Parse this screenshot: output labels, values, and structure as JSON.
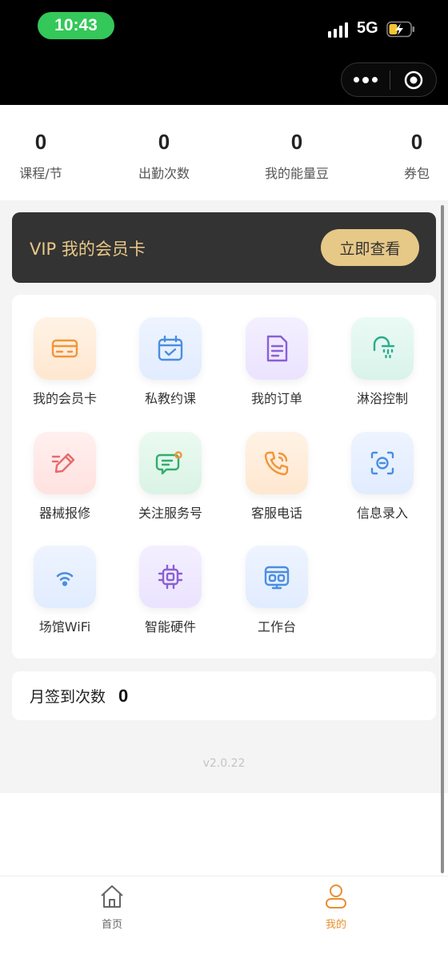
{
  "status_bar": {
    "time": "10:43",
    "network": "5G",
    "battery_color": "#f6c531"
  },
  "capsule": {
    "more_icon": "more-dots-icon",
    "close_icon": "target-circle-icon"
  },
  "stats": [
    {
      "value": "0",
      "label": "课程/节"
    },
    {
      "value": "0",
      "label": "出勤次数"
    },
    {
      "value": "0",
      "label": "我的能量豆"
    },
    {
      "value": "0",
      "label": "券包"
    }
  ],
  "vip": {
    "title": "VIP 我的会员卡",
    "button": "立即查看",
    "bg_color": "#333333",
    "accent_color": "#e6c887"
  },
  "menu": [
    {
      "label": "我的会员卡",
      "icon": "membership-card-icon",
      "color": "#f0963a"
    },
    {
      "label": "私教约课",
      "icon": "calendar-check-icon",
      "color": "#4a8ee0"
    },
    {
      "label": "我的订单",
      "icon": "document-icon",
      "color": "#8a5fd6"
    },
    {
      "label": "淋浴控制",
      "icon": "shower-icon",
      "color": "#2bab8c"
    },
    {
      "label": "器械报修",
      "icon": "edit-pen-icon",
      "color": "#e86a6a"
    },
    {
      "label": "关注服务号",
      "icon": "chat-bubble-icon",
      "color": "#2fae6e"
    },
    {
      "label": "客服电话",
      "icon": "phone-icon",
      "color": "#f0963a"
    },
    {
      "label": "信息录入",
      "icon": "face-scan-icon",
      "color": "#4a8ee0"
    },
    {
      "label": "场馆WiFi",
      "icon": "wifi-icon",
      "color": "#4a8ee0"
    },
    {
      "label": "智能硬件",
      "icon": "chip-icon",
      "color": "#8a5fd6"
    },
    {
      "label": "工作台",
      "icon": "workstation-icon",
      "color": "#4a8ee0"
    }
  ],
  "checkin": {
    "label": "月签到次数",
    "value": "0"
  },
  "version": "v2.0.22",
  "tabbar": [
    {
      "label": "首页",
      "icon": "home-icon",
      "active": false
    },
    {
      "label": "我的",
      "icon": "user-icon",
      "active": true
    }
  ],
  "colors": {
    "tab_active": "#e8902f",
    "tab_inactive": "#666666"
  }
}
